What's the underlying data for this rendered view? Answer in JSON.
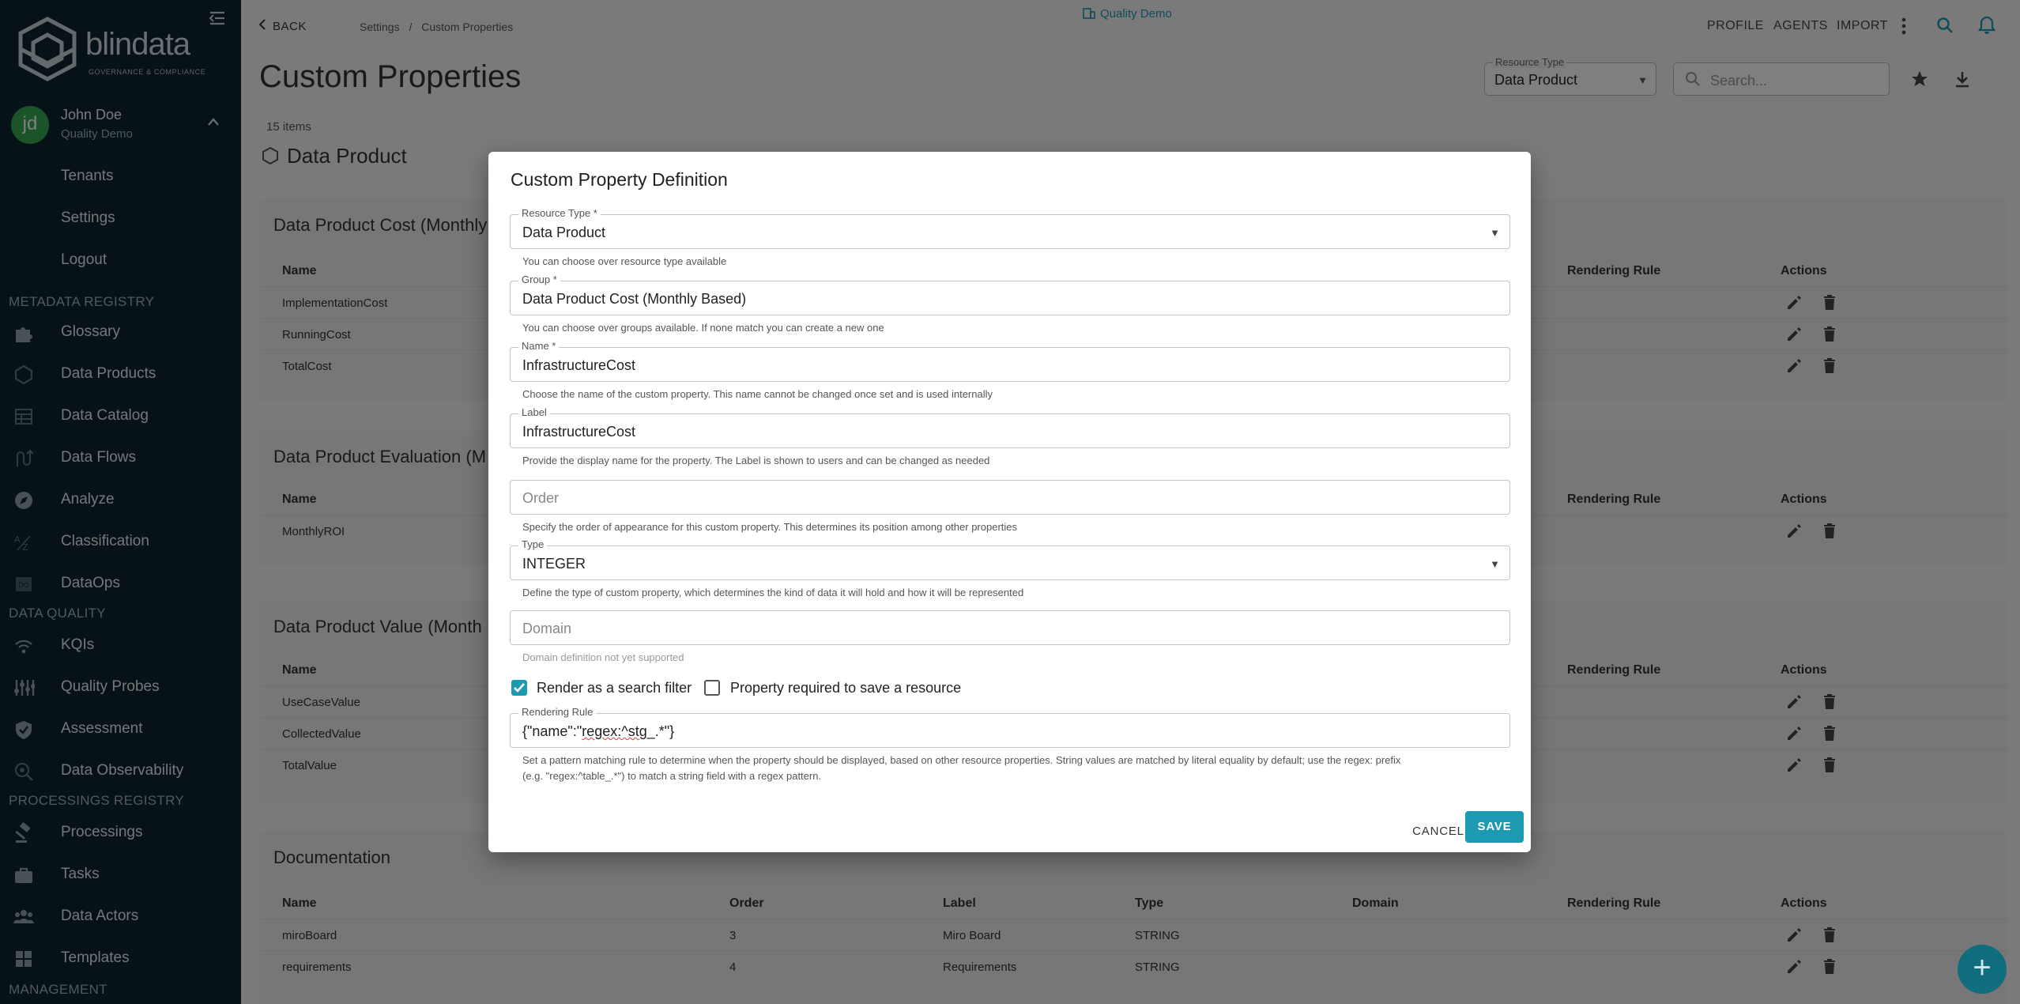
{
  "sidebar": {
    "brand": "blindata",
    "brand_tagline": "GOVERNANCE & COMPLIANCE",
    "user": {
      "initials": "jd",
      "name": "John Doe",
      "tenant": "Quality Demo"
    },
    "user_menu": [
      "Tenants",
      "Settings",
      "Logout"
    ],
    "sections": {
      "metadata": "METADATA REGISTRY",
      "quality": "DATA QUALITY",
      "processing": "PROCESSINGS REGISTRY",
      "management": "MANAGEMENT"
    },
    "metadata_items": [
      {
        "label": "Glossary",
        "icon": "puzzle-icon"
      },
      {
        "label": "Data Products",
        "icon": "hexagon-icon"
      },
      {
        "label": "Data Catalog",
        "icon": "table-icon"
      },
      {
        "label": "Data Flows",
        "icon": "flow-icon"
      },
      {
        "label": "Analyze",
        "icon": "compass-icon"
      },
      {
        "label": "Classification",
        "icon": "az-sort-icon"
      },
      {
        "label": "DataOps",
        "icon": "dataops-icon"
      }
    ],
    "quality_items": [
      {
        "label": "KQIs",
        "icon": "signal-icon"
      },
      {
        "label": "Quality Probes",
        "icon": "probe-icon"
      },
      {
        "label": "Assessment",
        "icon": "shield-check-icon"
      },
      {
        "label": "Data Observability",
        "icon": "observability-icon"
      }
    ],
    "processing_items": [
      {
        "label": "Processings",
        "icon": "gavel-icon"
      },
      {
        "label": "Tasks",
        "icon": "briefcase-icon"
      },
      {
        "label": "Data Actors",
        "icon": "people-icon"
      },
      {
        "label": "Templates",
        "icon": "template-icon"
      }
    ]
  },
  "topbar": {
    "back": "BACK",
    "breadcrumb": [
      "Settings",
      "/",
      "Custom Properties"
    ],
    "tenant": "Quality Demo",
    "nav": [
      "PROFILE",
      "AGENTS",
      "IMPORT"
    ]
  },
  "page": {
    "title": "Custom Properties",
    "resource_type_label": "Resource Type",
    "resource_type_value": "Data Product",
    "search_placeholder": "Search...",
    "count": "15 items",
    "section_title": "Data Product"
  },
  "cards": [
    {
      "title": "Data Product Cost (Monthly",
      "rows": [
        {
          "name": "ImplementationCost"
        },
        {
          "name": "RunningCost"
        },
        {
          "name": "TotalCost"
        }
      ]
    },
    {
      "title": "Data Product Evaluation (M",
      "rows": [
        {
          "name": "MonthlyROI"
        }
      ]
    },
    {
      "title": "Data Product Value (Month",
      "rows": [
        {
          "name": "UseCaseValue"
        },
        {
          "name": "CollectedValue"
        },
        {
          "name": "TotalValue"
        }
      ]
    },
    {
      "title": "Documentation",
      "rows": [
        {
          "name": "miroBoard",
          "order": "3",
          "label": "Miro Board",
          "type": "STRING"
        },
        {
          "name": "requirements",
          "order": "4",
          "label": "Requirements",
          "type": "STRING"
        }
      ]
    }
  ],
  "columns": {
    "name": "Name",
    "order": "Order",
    "label": "Label",
    "type": "Type",
    "domain": "Domain",
    "rendering_rule": "Rendering Rule",
    "actions": "Actions"
  },
  "dialog": {
    "title": "Custom Property Definition",
    "resource_type": {
      "label": "Resource Type *",
      "value": "Data Product",
      "help": "You can choose over resource type available"
    },
    "group": {
      "label": "Group *",
      "value": "Data Product Cost (Monthly Based)",
      "help": "You can choose over groups available. If none match you can create a new one"
    },
    "name": {
      "label": "Name *",
      "value": "InfrastructureCost",
      "help": "Choose the name of the custom property. This name cannot be changed once set and is used internally"
    },
    "label": {
      "label": "Label",
      "value": "InfrastructureCost",
      "help": "Provide the display name for the property. The Label is shown to users and can be changed as needed"
    },
    "order": {
      "placeholder": "Order",
      "help": "Specify the order of appearance for this custom property. This determines its position among other properties"
    },
    "type": {
      "label": "Type",
      "value": "INTEGER",
      "help": "Define the type of custom property, which determines the kind of data it will hold and how it will be represented"
    },
    "domain": {
      "placeholder": "Domain",
      "help": "Domain definition not yet supported"
    },
    "search_filter": {
      "label": "Render as a search filter",
      "checked": true
    },
    "required": {
      "label": "Property required to save a resource",
      "checked": false
    },
    "rendering_rule": {
      "label": "Rendering Rule",
      "value_prefix": "{\"name\":\"",
      "value_squiggle": "regex:^stg",
      "value_suffix": "_.*\"}",
      "help_line1": "Set a pattern matching rule to determine when the property should be displayed, based on other resource properties. String values are matched by literal equality by default; use the regex: prefix",
      "help_line2": "(e.g. \"regex:^table_.*\") to match a string field with a regex pattern."
    },
    "cancel": "CANCEL",
    "save": "SAVE"
  },
  "colors": {
    "accent": "#1b9ab2",
    "sidebar": "#0f2530",
    "avatar": "#36a853"
  }
}
